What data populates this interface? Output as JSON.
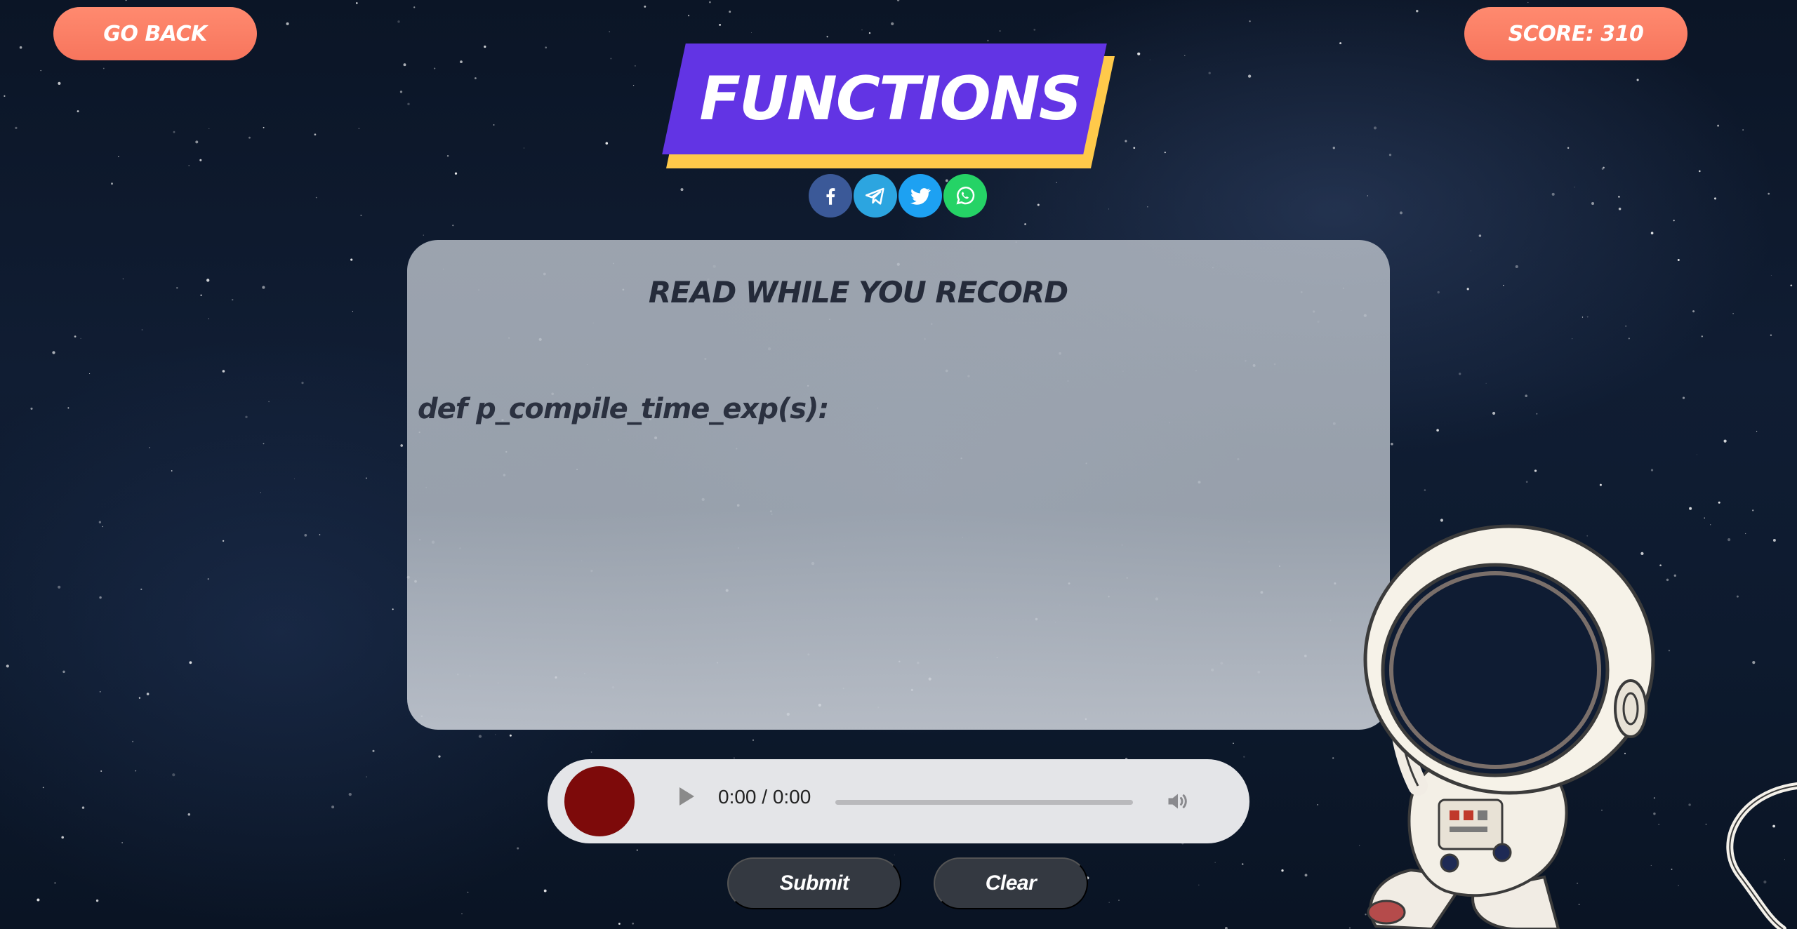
{
  "header": {
    "go_back_label": "GO BACK",
    "score_label": "SCORE: 310"
  },
  "title": {
    "text": "FUNCTIONS",
    "bg_color": "#6234e4",
    "shadow_color": "#ffc94a"
  },
  "share": {
    "icons": [
      {
        "name": "facebook-icon",
        "color": "#3b5998"
      },
      {
        "name": "telegram-icon",
        "color": "#2ca5e0"
      },
      {
        "name": "twitter-icon",
        "color": "#1da1f2"
      },
      {
        "name": "whatsapp-icon",
        "color": "#25d366"
      }
    ]
  },
  "panel": {
    "heading": "READ WHILE YOU RECORD",
    "code": "def p_compile_time_exp(s):"
  },
  "audio": {
    "time": "0:00 / 0:00",
    "progress": 0,
    "record_color": "#7d0a0a"
  },
  "actions": {
    "submit_label": "Submit",
    "clear_label": "Clear"
  },
  "colors": {
    "accent": "#f7755d",
    "button_dark": "#343941"
  }
}
